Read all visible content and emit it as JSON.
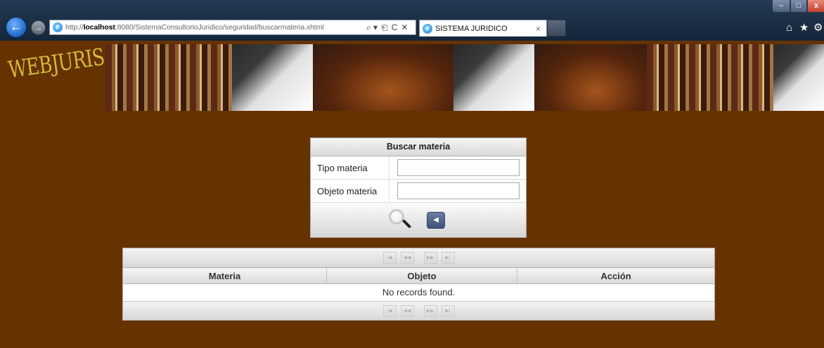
{
  "browser": {
    "url_proto": "http://",
    "url_host": "localhost",
    "url_path": ":8080/SistemaConsultorioJuridico/seguridad/buscarmateria.xhtml",
    "tab_title": "SISTEMA JURIDICO",
    "tab_close": "×",
    "addr_search": "⌕ ▾",
    "addr_compat": "⎗",
    "addr_refresh": "C",
    "addr_stop": "✕",
    "back_glyph": "←",
    "forward_glyph": "→",
    "win_min": "–",
    "win_max": "□",
    "win_close": "x",
    "home_glyph": "⌂",
    "fav_glyph": "★",
    "tools_glyph": "⚙"
  },
  "branding": {
    "logo_text": "WEBJURIS"
  },
  "search_panel": {
    "title": "Buscar materia",
    "fields": [
      {
        "label": "Tipo materia",
        "value": ""
      },
      {
        "label": "Objeto materia",
        "value": ""
      }
    ],
    "back_glyph": "◀"
  },
  "table": {
    "pager": {
      "first": "|◀",
      "prev": "◀◀",
      "next": "▶▶",
      "last": "▶|"
    },
    "columns": [
      "Materia",
      "Objeto",
      "Acción"
    ],
    "empty_message": "No records found."
  },
  "colors": {
    "page_bg": "#663300",
    "logo": "#d8b640"
  },
  "icons": [
    "back-arrow-icon",
    "forward-arrow-icon",
    "ie-icon",
    "search-icon",
    "refresh-icon",
    "stop-icon",
    "home-icon",
    "favorites-star-icon",
    "tools-gear-icon",
    "magnifier-icon",
    "back-triangle-icon"
  ]
}
